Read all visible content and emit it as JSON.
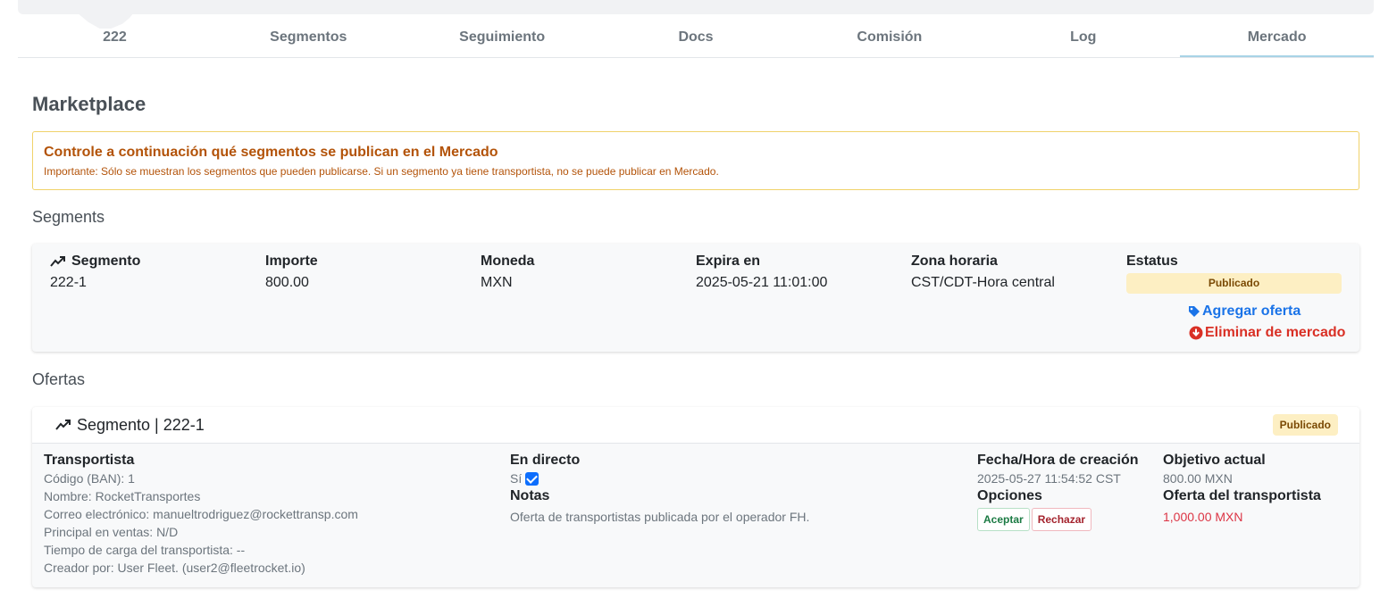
{
  "tabs": [
    {
      "label": "222",
      "active": false
    },
    {
      "label": "Segmentos",
      "active": false
    },
    {
      "label": "Seguimiento",
      "active": false
    },
    {
      "label": "Docs",
      "active": false
    },
    {
      "label": "Comisión",
      "active": false
    },
    {
      "label": "Log",
      "active": false
    },
    {
      "label": "Mercado",
      "active": true
    }
  ],
  "page_title": "Marketplace",
  "alert": {
    "title": "Controle a continuación qué segmentos se publican en el Mercado",
    "text": "Importante: Sólo se muestran los segmentos que pueden publicarse. Si un segmento ya tiene transportista, no se puede publicar en Mercado."
  },
  "segments_label": "Segments",
  "segment_table": {
    "headers": {
      "segment": "Segmento",
      "amount": "Importe",
      "currency": "Moneda",
      "expires": "Expira en",
      "timezone": "Zona horaria",
      "status": "Estatus"
    },
    "row": {
      "segment": "222-1",
      "amount": "800.00",
      "currency": "MXN",
      "expires": "2025-05-21 11:01:00",
      "timezone": "CST/CDT-Hora central",
      "status": "Publicado"
    },
    "actions": {
      "add_offer": "Agregar oferta",
      "remove_market": "Eliminar de mercado"
    }
  },
  "offers_label": "Ofertas",
  "offer": {
    "header_title": "Segmento | 222-1",
    "status": "Publicado",
    "carrier": {
      "heading": "Transportista",
      "code": "Código (BAN): 1",
      "name": "Nombre: RocketTransportes",
      "email": "Correo electrónico: manueltrodriguez@rockettransp.com",
      "sales_lead": "Principal en ventas: N/D",
      "load_time": "Tiempo de carga del transportista: --",
      "created_by": "Creador por: User Fleet. (user2@fleetrocket.io)"
    },
    "live": {
      "heading": "En directo",
      "value": "Sí"
    },
    "notes": {
      "heading": "Notas",
      "text": "Oferta de transportistas publicada por el operador FH."
    },
    "created": {
      "heading": "Fecha/Hora de creación",
      "value": "2025-05-27 11:54:52 CST"
    },
    "options": {
      "heading": "Opciones",
      "accept": "Aceptar",
      "reject": "Rechazar"
    },
    "target": {
      "heading": "Objetivo actual",
      "value": "800.00 MXN"
    },
    "carrier_offer": {
      "heading": "Oferta del transportista",
      "value": "1,000.00 MXN"
    }
  },
  "colors": {
    "accent_blue": "#1a73e8",
    "danger_red": "#d93025",
    "warning_text": "#b35309",
    "badge_bg": "#fdefc3"
  }
}
